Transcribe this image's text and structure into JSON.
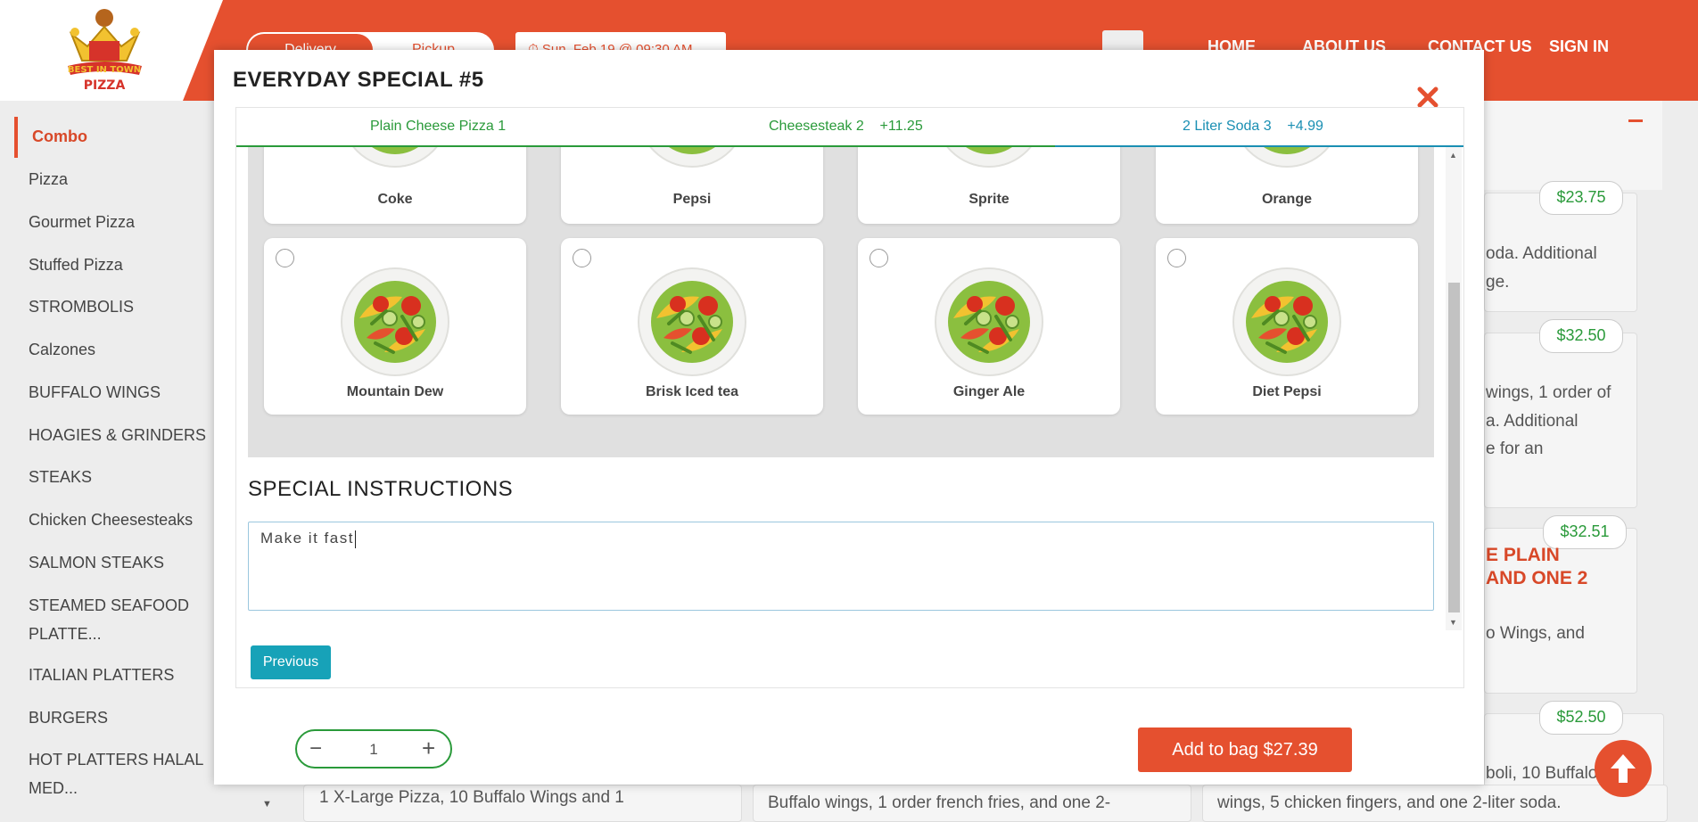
{
  "header": {
    "toggle_active": "Delivery",
    "toggle_other": "Pickup",
    "date_text": "⏱ Sun, Feb 19 @ 09:30 AM",
    "nav": [
      "HOME",
      "ABOUT US",
      "CONTACT US",
      "SIGN IN"
    ]
  },
  "sidebar": {
    "items": [
      "Combo",
      "Pizza",
      "Gourmet Pizza",
      "Stuffed Pizza",
      "STROMBOLIS",
      "Calzones",
      "BUFFALO WINGS",
      "HOAGIES & GRINDERS",
      "STEAKS",
      "Chicken Cheesesteaks",
      "SALMON STEAKS",
      "STEAMED SEAFOOD PLATTE...",
      "ITALIAN PLATTERS",
      "BURGERS",
      "HOT PLATTERS HALAL MED..."
    ]
  },
  "background": {
    "prices": [
      "$23.75",
      "$32.50",
      "$32.51",
      "$52.50"
    ],
    "texts": [
      "oda. Additional",
      "ge.",
      "wings, 1 order of",
      "a. Additional",
      "e for an",
      "E PLAIN",
      "AND ONE 2",
      "o Wings, and",
      "boli, 10 Buffalo",
      "1 X-Large Pizza, 10 Buffalo Wings and 1",
      "Buffalo wings, 1 order french fries, and one 2-",
      "wings, 5 chicken fingers, and one 2-liter soda."
    ]
  },
  "modal": {
    "title": "EVERYDAY SPECIAL #5",
    "steps": [
      {
        "label": "Plain Cheese Pizza 1",
        "price": ""
      },
      {
        "label": "Cheesesteak 2",
        "price": "+11.25"
      },
      {
        "label": "2 Liter Soda 3",
        "price": "+4.99"
      }
    ],
    "drinks_row1": [
      "Coke",
      "Pepsi",
      "Sprite",
      "Orange"
    ],
    "drinks_row2": [
      "Mountain Dew",
      "Brisk Iced tea",
      "Ginger Ale",
      "Diet Pepsi"
    ],
    "special_instructions_title": "SPECIAL INSTRUCTIONS",
    "special_instructions_value": "Make it fast",
    "previous_label": "Previous",
    "quantity": "1",
    "add_to_bag_label": "Add to bag $27.39"
  },
  "colors": {
    "brand": "#e5502f",
    "step_done": "#2a9a3a",
    "step_current": "#1a8fb3",
    "button_teal": "#17a2b8"
  }
}
